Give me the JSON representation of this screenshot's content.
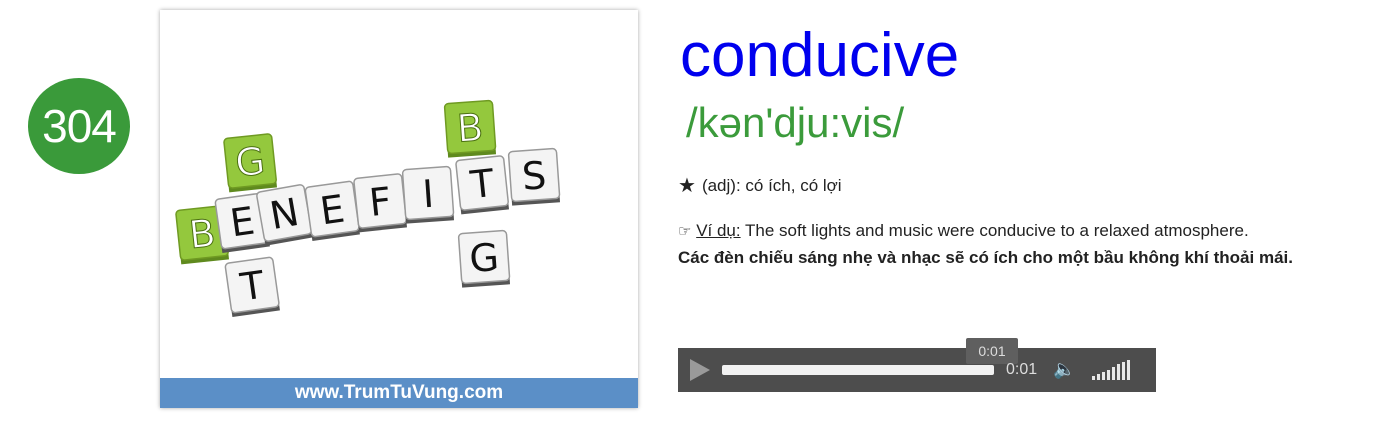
{
  "badge": {
    "number": "304"
  },
  "card": {
    "footer_url": "www.TrumTuVung.com",
    "tiles": [
      {
        "letter": "B",
        "green": true
      },
      {
        "letter": "E",
        "green": false
      },
      {
        "letter": "N",
        "green": false
      },
      {
        "letter": "E",
        "green": false
      },
      {
        "letter": "F",
        "green": false
      },
      {
        "letter": "I",
        "green": false
      },
      {
        "letter": "T",
        "green": false
      },
      {
        "letter": "S",
        "green": false
      },
      {
        "letter": "G",
        "green": true
      },
      {
        "letter": "T",
        "green": false
      },
      {
        "letter": "B",
        "green": true
      },
      {
        "letter": "G",
        "green": false
      }
    ],
    "colors": {
      "green": "#94c83d",
      "footer": "#5b8fc7"
    }
  },
  "entry": {
    "word": "conducive",
    "phonetic": "/kən'dju:vis/",
    "definition": "(adj): có ích, có lợi",
    "example_label": "Ví dụ:",
    "example_text": " The soft lights and music were conducive to a relaxed atmosphere.",
    "translation": "Các đèn chiếu sáng nhẹ và nhạc sẽ có ích cho một bầu không khí thoải mái."
  },
  "player": {
    "tooltip_time": "0:01",
    "current_time": "0:01",
    "progress": 1.0,
    "icons": [
      "play-icon",
      "volume-icon",
      "volume-level-icon"
    ]
  },
  "colors": {
    "word": "#0000ee",
    "phonetic": "#3b9b3b",
    "badge": "#3a9a3a"
  }
}
